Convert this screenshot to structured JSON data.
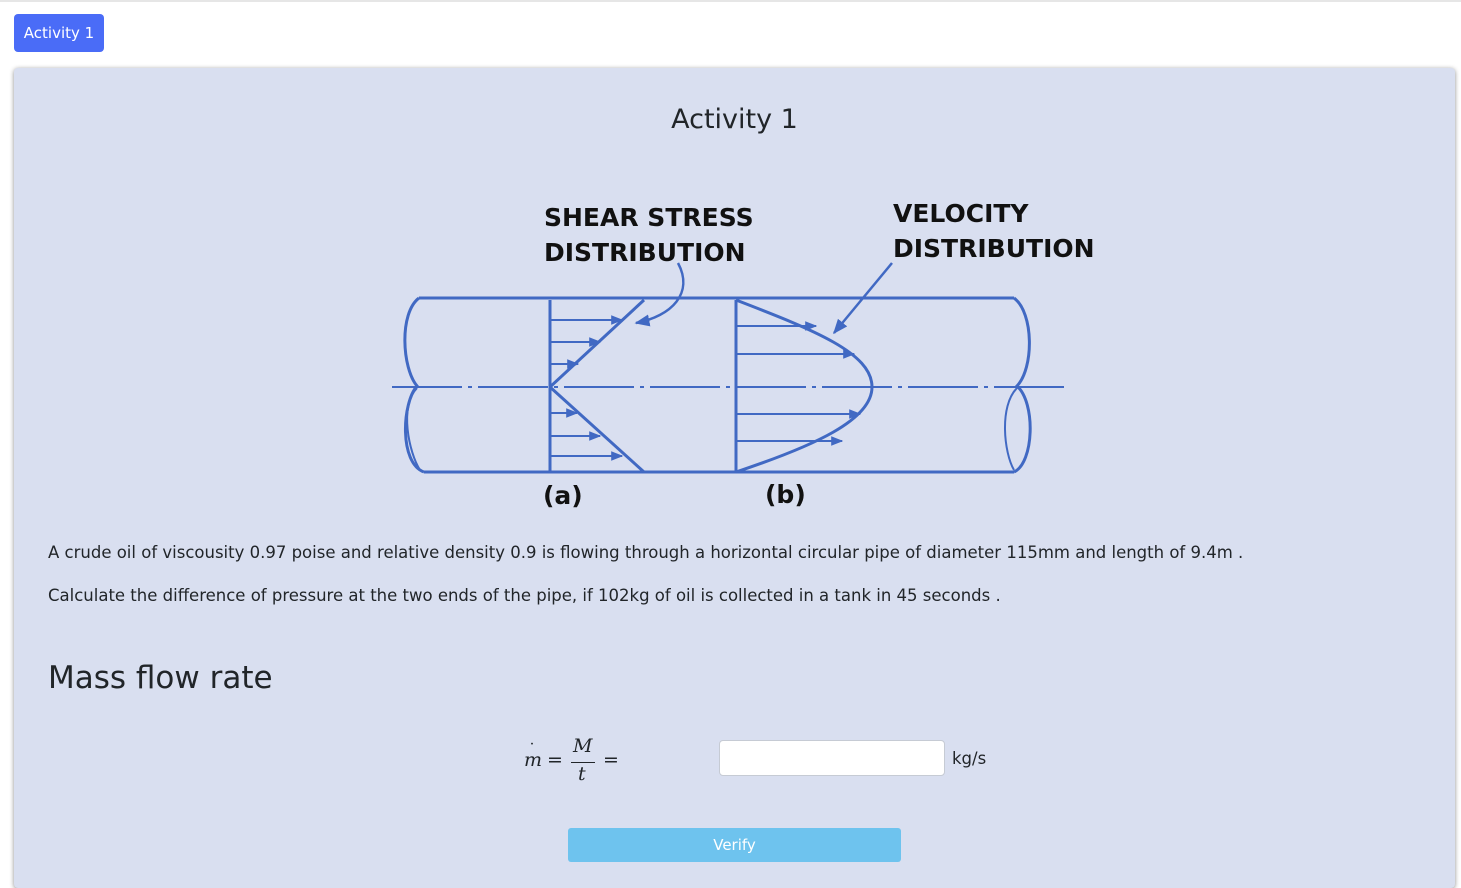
{
  "tab": {
    "label": "Activity 1"
  },
  "card": {
    "title": "Activity 1"
  },
  "figure": {
    "shear_label_line1": "SHEAR STRESS",
    "shear_label_line2": "DISTRIBUTION",
    "velocity_label_line1": "VELOCITY",
    "velocity_label_line2": "DISTRIBUTION",
    "label_a": "(a)",
    "label_b": "(b)",
    "line_color": "#4169c3"
  },
  "problem": {
    "line1": "A crude oil of viscousity 0.97 poise and relative density 0.9 is flowing through a horizontal circular pipe of diameter 115mm and length of 9.4m .",
    "line2": "Calculate the difference of pressure at the two ends of the pipe, if 102kg of oil is collected in a tank in 45 seconds ."
  },
  "section": {
    "heading": "Mass flow rate"
  },
  "formula": {
    "lhs": "m",
    "dot": "˙",
    "eq": "=",
    "numerator": "M",
    "denominator": "t"
  },
  "answer": {
    "value": "",
    "placeholder": "",
    "unit": "kg/s"
  },
  "verify": {
    "label": "Verify"
  },
  "colors": {
    "accent": "#4a6cf7",
    "card_bg": "#d9dff0",
    "verify_bg": "#6ec3ee"
  }
}
